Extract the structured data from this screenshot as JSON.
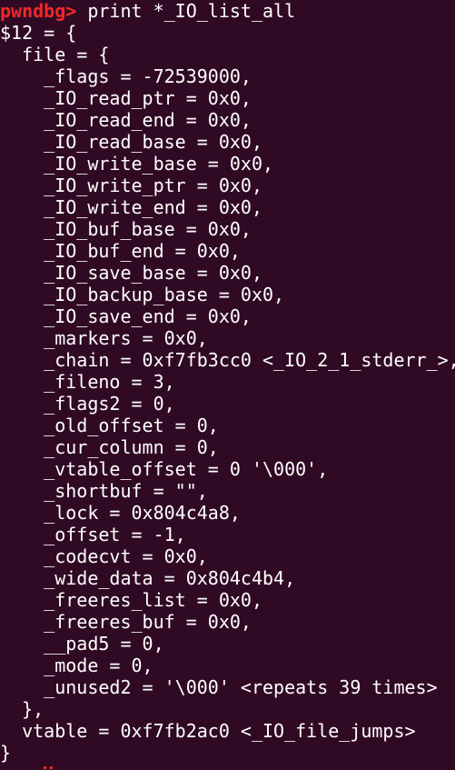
{
  "terminal": {
    "prompt": "pwndbg>",
    "command": " print *_IO_list_all",
    "background_color": "#300a24",
    "prompt_color": "#ef2929",
    "text_color": "#ffffff",
    "lines": [
      "$12 = {",
      "  file = {",
      "    _flags = -72539000,",
      "    _IO_read_ptr = 0x0,",
      "    _IO_read_end = 0x0,",
      "    _IO_read_base = 0x0,",
      "    _IO_write_base = 0x0,",
      "    _IO_write_ptr = 0x0,",
      "    _IO_write_end = 0x0,",
      "    _IO_buf_base = 0x0,",
      "    _IO_buf_end = 0x0,",
      "    _IO_save_base = 0x0,",
      "    _IO_backup_base = 0x0,",
      "    _IO_save_end = 0x0,",
      "    _markers = 0x0,",
      "    _chain = 0xf7fb3cc0 <_IO_2_1_stderr_>,",
      "    _fileno = 3,",
      "    _flags2 = 0,",
      "    _old_offset = 0,",
      "    _cur_column = 0,",
      "    _vtable_offset = 0 '\\000',",
      "    _shortbuf = \"\",",
      "    _lock = 0x804c4a8,",
      "    _offset = -1,",
      "    _codecvt = 0x0,",
      "    _wide_data = 0x804c4b4,",
      "    _freeres_list = 0x0,",
      "    _freeres_buf = 0x0,",
      "    __pad5 = 0,",
      "    _mode = 0,",
      "    _unused2 = '\\000' <repeats 39 times>",
      "  },",
      "  vtable = 0xf7fb2ac0 <_IO_file_jumps>",
      "}"
    ]
  }
}
